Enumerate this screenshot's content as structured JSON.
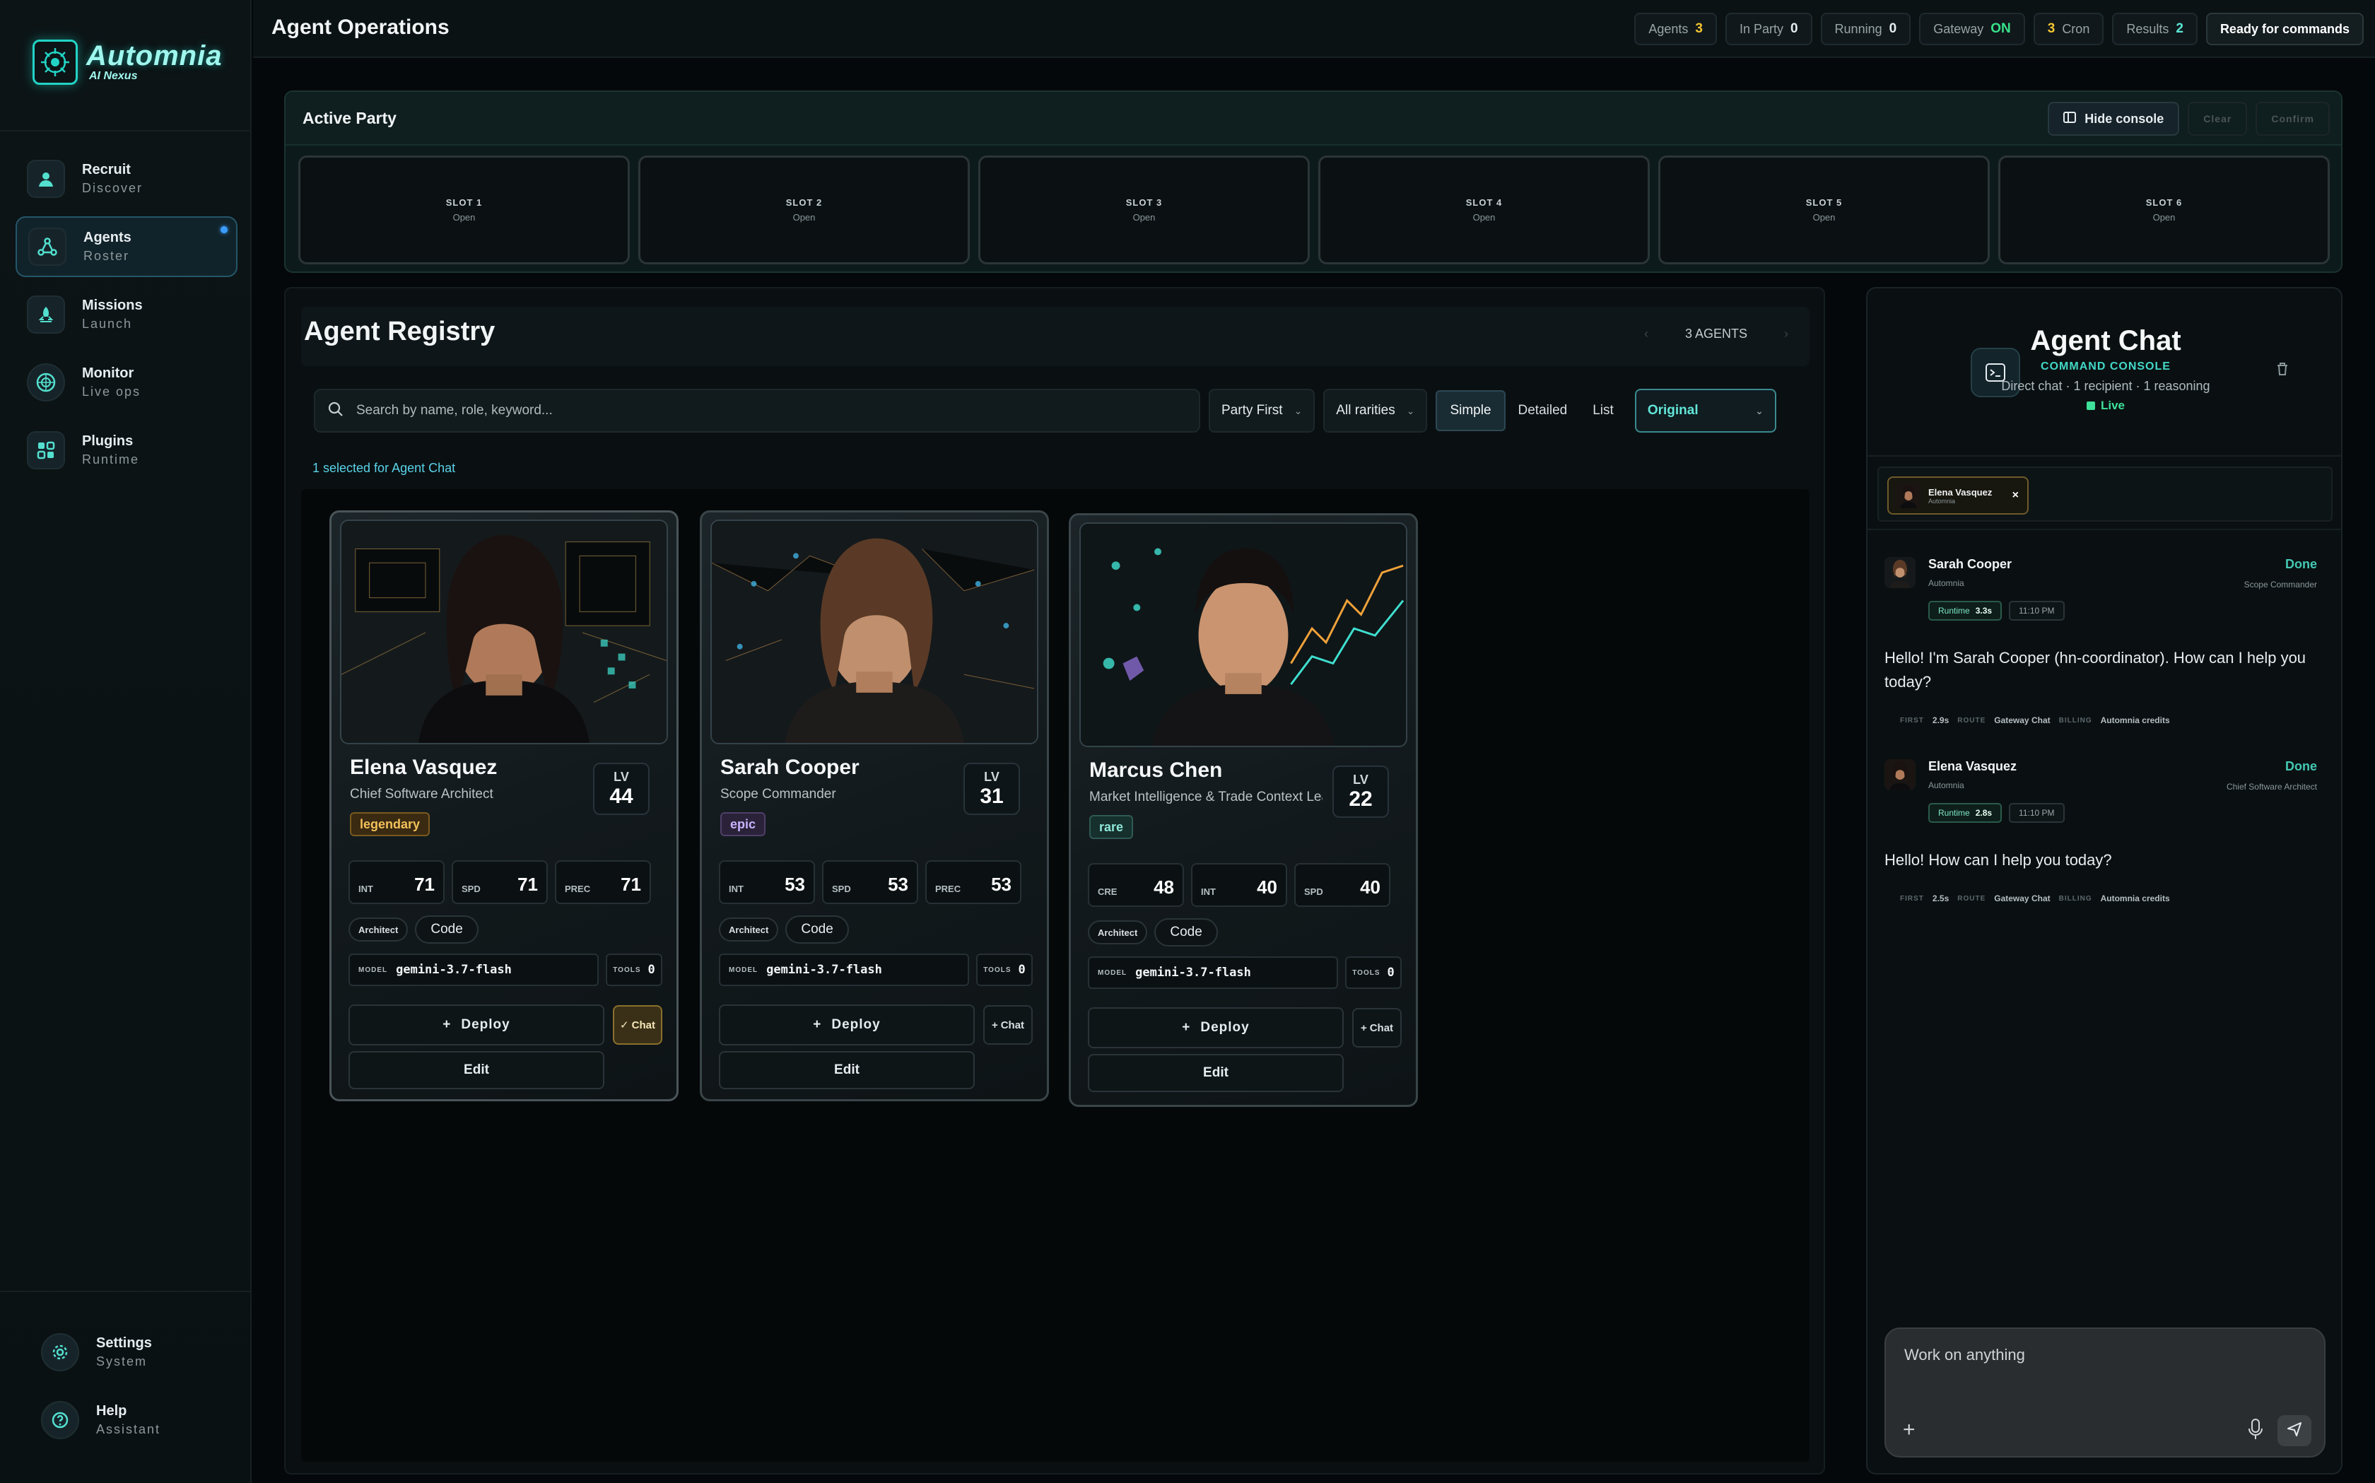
{
  "app": {
    "logo_title": "Automnia",
    "logo_subtitle": "AI Nexus",
    "brand_color": "#22d3c5"
  },
  "sidebar": {
    "items": [
      {
        "label": "Recruit",
        "sub": "Discover",
        "icon": "person-icon"
      },
      {
        "label": "Agents",
        "sub": "Roster",
        "icon": "network-icon",
        "active": true
      },
      {
        "label": "Missions",
        "sub": "Launch",
        "icon": "rocket-icon"
      },
      {
        "label": "Monitor",
        "sub": "Live ops",
        "icon": "radar-icon"
      },
      {
        "label": "Plugins",
        "sub": "Runtime",
        "icon": "plugin-icon"
      }
    ],
    "bottom": [
      {
        "label": "Settings",
        "sub": "System",
        "icon": "gear-icon"
      },
      {
        "label": "Help",
        "sub": "Assistant",
        "icon": "help-icon"
      }
    ]
  },
  "header": {
    "title": "Agent Operations",
    "stats": [
      {
        "label": "Agents",
        "value": "3"
      },
      {
        "label": "In Party",
        "value": "0"
      },
      {
        "label": "Running",
        "value": "0"
      },
      {
        "label": "Gateway",
        "value": "ON"
      },
      {
        "label": "Cron",
        "value": "3"
      },
      {
        "label": "Results",
        "value": "2"
      }
    ],
    "ready_label": "Ready for commands"
  },
  "party": {
    "title": "Active Party",
    "hide_console": "Hide console",
    "clear": "Clear",
    "confirm": "Confirm",
    "slots": [
      {
        "name": "SLOT 1",
        "state": "Open"
      },
      {
        "name": "SLOT 2",
        "state": "Open"
      },
      {
        "name": "SLOT 3",
        "state": "Open"
      },
      {
        "name": "SLOT 4",
        "state": "Open"
      },
      {
        "name": "SLOT 5",
        "state": "Open"
      },
      {
        "name": "SLOT 6",
        "state": "Open"
      }
    ]
  },
  "registry": {
    "title": "Agent Registry",
    "count": "3 AGENTS",
    "search_placeholder": "Search by name, role, keyword...",
    "sort": "Party First",
    "rarity_filter": "All rarities",
    "views": [
      "Simple",
      "Detailed",
      "List"
    ],
    "active_view": "Simple",
    "style": "Original",
    "selected_note": "1 selected for Agent Chat",
    "deploy_label": "Deploy",
    "edit_label": "Edit",
    "chat_label": "Chat",
    "model_key": "MODEL",
    "tools_key": "TOOLS",
    "lv_key": "LV",
    "agents": [
      {
        "name": "Elena Vasquez",
        "role": "Chief Software Architect",
        "level": "44",
        "rarity": "legendary",
        "stats": [
          {
            "k": "INT",
            "v": "71"
          },
          {
            "k": "SPD",
            "v": "71"
          },
          {
            "k": "PREC",
            "v": "71"
          }
        ],
        "tag_class": "Architect",
        "tag_skill": "Code",
        "model": "gemini-3.7-flash",
        "tools": "0",
        "chat_selected": true
      },
      {
        "name": "Sarah Cooper",
        "role": "Scope Commander",
        "level": "31",
        "rarity": "epic",
        "stats": [
          {
            "k": "INT",
            "v": "53"
          },
          {
            "k": "SPD",
            "v": "53"
          },
          {
            "k": "PREC",
            "v": "53"
          }
        ],
        "tag_class": "Architect",
        "tag_skill": "Code",
        "model": "gemini-3.7-flash",
        "tools": "0",
        "chat_selected": false
      },
      {
        "name": "Marcus Chen",
        "role": "Market Intelligence & Trade Context Lead",
        "level": "22",
        "rarity": "rare",
        "stats": [
          {
            "k": "CRE",
            "v": "48"
          },
          {
            "k": "INT",
            "v": "40"
          },
          {
            "k": "SPD",
            "v": "40"
          }
        ],
        "tag_class": "Architect",
        "tag_skill": "Code",
        "model": "gemini-3.7-flash",
        "tools": "0",
        "chat_selected": false
      }
    ]
  },
  "chat": {
    "title": "Agent Chat",
    "subtitle": "COMMAND CONSOLE",
    "meta": "Direct chat · 1 recipient · 1 reasoning",
    "live": "Live",
    "recipient": {
      "name": "Elena Vasquez",
      "org": "Automnia"
    },
    "messages": [
      {
        "name": "Sarah Cooper",
        "org": "Automnia",
        "status": "Done",
        "role": "Scope Commander",
        "runtime_label": "Runtime",
        "runtime": "3.3s",
        "time": "11:10 PM",
        "text": "Hello! I'm Sarah Cooper (hn-coordinator). How can I help you today?",
        "first_label": "FIRST",
        "first": "2.9s",
        "route_label": "ROUTE",
        "route": "Gateway Chat",
        "billing_label": "BILLING",
        "billing": "Automnia credits"
      },
      {
        "name": "Elena Vasquez",
        "org": "Automnia",
        "status": "Done",
        "role": "Chief Software Architect",
        "runtime_label": "Runtime",
        "runtime": "2.8s",
        "time": "11:10 PM",
        "text": "Hello! How can I help you today?",
        "first_label": "FIRST",
        "first": "2.5s",
        "route_label": "ROUTE",
        "route": "Gateway Chat",
        "billing_label": "BILLING",
        "billing": "Automnia credits"
      }
    ],
    "composer_placeholder": "Work on anything"
  }
}
